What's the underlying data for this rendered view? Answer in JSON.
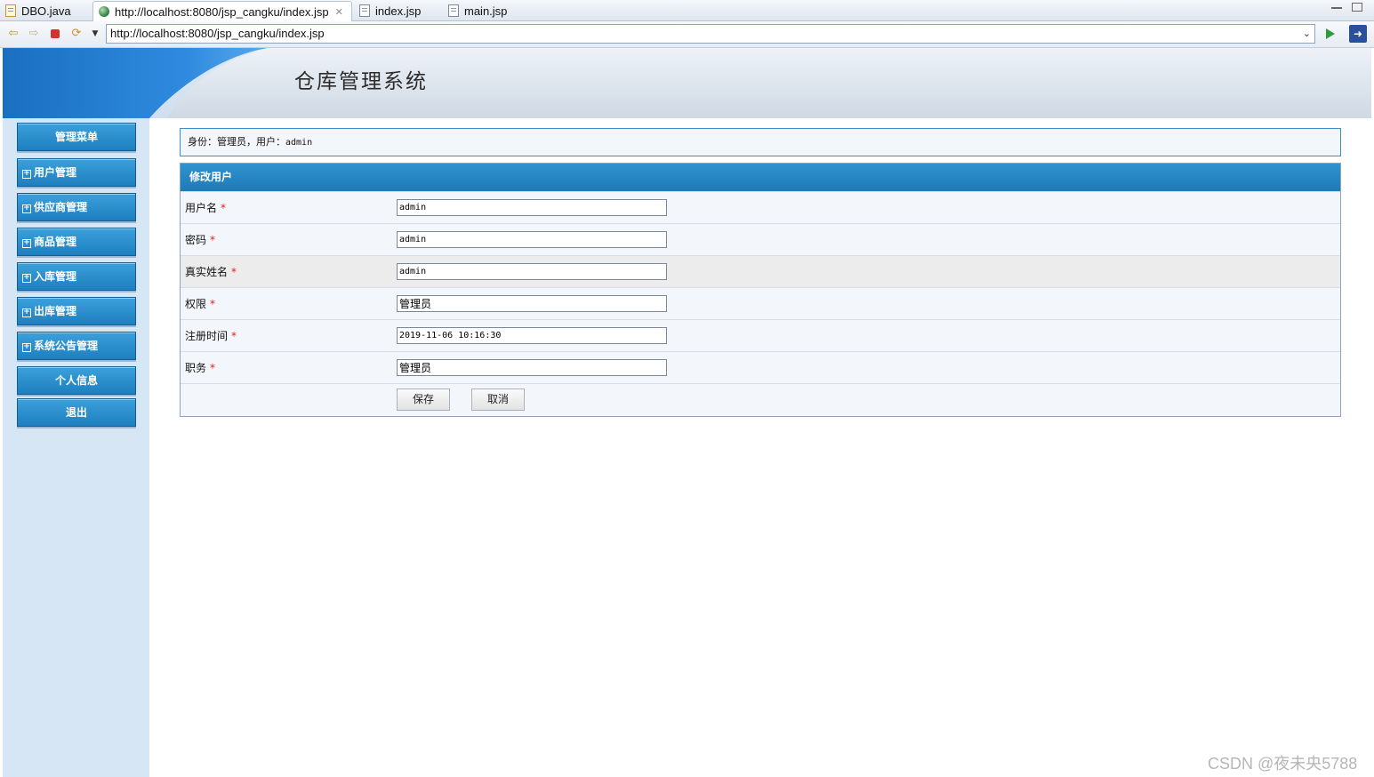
{
  "editor_tabs": [
    {
      "label": "DBO.java",
      "icon": "java-file-icon"
    },
    {
      "label": "http://localhost:8080/jsp_cangku/index.jsp",
      "icon": "globe-icon",
      "active": true
    },
    {
      "label": "index.jsp",
      "icon": "jsp-file-icon"
    },
    {
      "label": "main.jsp",
      "icon": "jsp-file-icon"
    }
  ],
  "toolbar": {
    "url": "http://localhost:8080/jsp_cangku/index.jsp",
    "tab_close_glyph": "✕"
  },
  "header": {
    "title": "仓库管理系统"
  },
  "sidebar": {
    "title": "管理菜单",
    "items": [
      {
        "label": "用户管理"
      },
      {
        "label": "供应商管理"
      },
      {
        "label": "商品管理"
      },
      {
        "label": "入库管理"
      },
      {
        "label": "出库管理"
      },
      {
        "label": "系统公告管理"
      }
    ],
    "profile": "个人信息",
    "logout": "退出",
    "expand_glyph": "+"
  },
  "identity": {
    "prefix": "身份：管理员，用户：",
    "username": "admin"
  },
  "form": {
    "title": "修改用户",
    "required_mark": "*",
    "fields": [
      {
        "label": "用户名",
        "value": "admin"
      },
      {
        "label": "密码",
        "value": "admin"
      },
      {
        "label": "真实姓名",
        "value": "admin"
      },
      {
        "label": "权限",
        "value": "管理员"
      },
      {
        "label": "注册时间",
        "value": "2019-11-06 10:16:30"
      },
      {
        "label": "职务",
        "value": "管理员"
      }
    ],
    "save": "保存",
    "cancel": "取消"
  },
  "watermark": "CSDN @夜未央5788",
  "colors": {
    "accent": "#1f7fc0",
    "sidebar_bg": "#d7e6f5",
    "required": "#dd2222"
  }
}
